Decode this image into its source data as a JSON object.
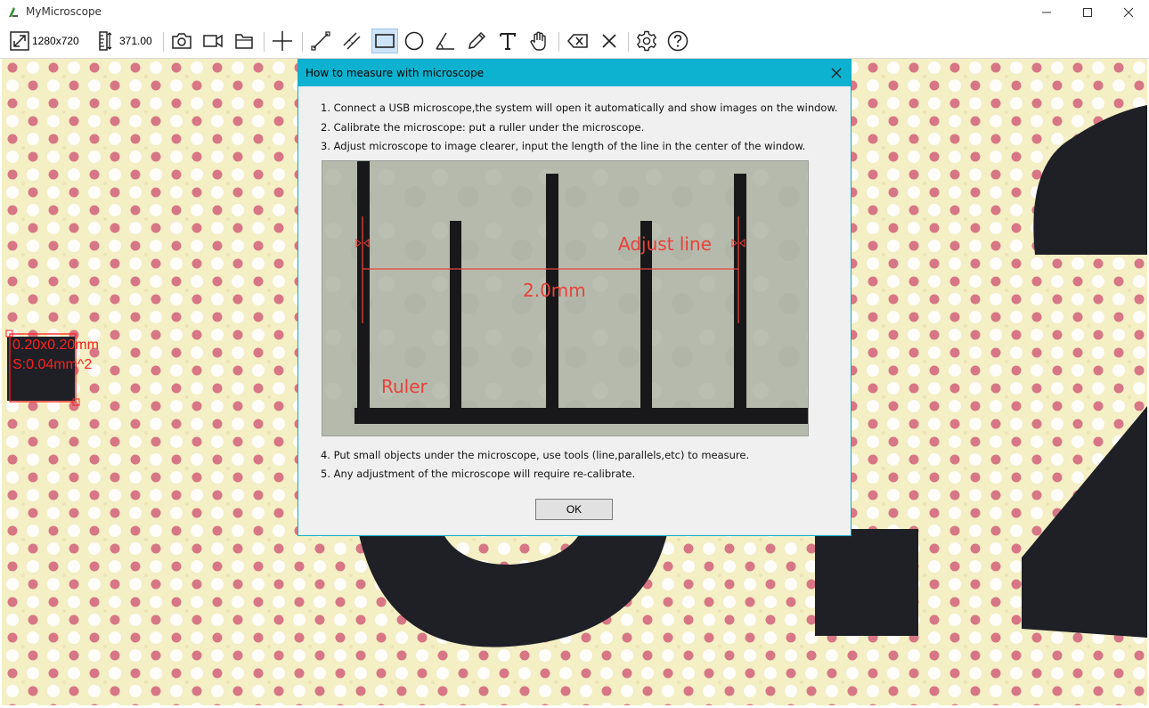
{
  "window": {
    "title": "MyMicroscope",
    "icons": [
      "app-icon",
      "minimize-icon",
      "maximize-icon",
      "close-icon"
    ]
  },
  "toolbar": {
    "resolution": "1280x720",
    "calibration": "371.00",
    "tools": [
      "resize-icon",
      "ruler-icon",
      "camera-icon",
      "video-icon",
      "folder-icon",
      "crosshair-icon",
      "line-icon",
      "parallel-lines-icon",
      "rectangle-icon",
      "circle-icon",
      "angle-icon",
      "pencil-icon",
      "text-icon",
      "hand-icon",
      "erase-icon",
      "clear-icon",
      "settings-icon",
      "help-icon"
    ],
    "active_tool": "rectangle-icon"
  },
  "canvas": {
    "measurement": {
      "line1": "0.20x0.20mm",
      "line2": "S:0.04mm^2"
    },
    "colors": {
      "background": "#f4efc4",
      "dot_red": "#d2607a",
      "dot_white": "#ffffff",
      "print_black": "#1e2026",
      "annotation": "#ff2020"
    }
  },
  "dialog": {
    "title": "How to measure with microscope",
    "steps_top": [
      "1. Connect a USB microscope,the system will open it automatically and show images on the window.",
      "2. Calibrate the microscope: put a ruller under the microscope.",
      "3. Adjust microscope to image clearer, input the length of the line in the center of the window."
    ],
    "image": {
      "adjust_label": "Adjust line",
      "length_label": "2.0mm",
      "ruler_label": "Ruler"
    },
    "steps_bottom": [
      "4. Put small objects under the microscope, use tools (line,parallels,etc) to measure.",
      "5. Any adjustment of the microscope will require re-calibrate."
    ],
    "ok_label": "OK",
    "colors": {
      "titlebar": "#0cb2cf",
      "body": "#f0f0f0"
    }
  }
}
